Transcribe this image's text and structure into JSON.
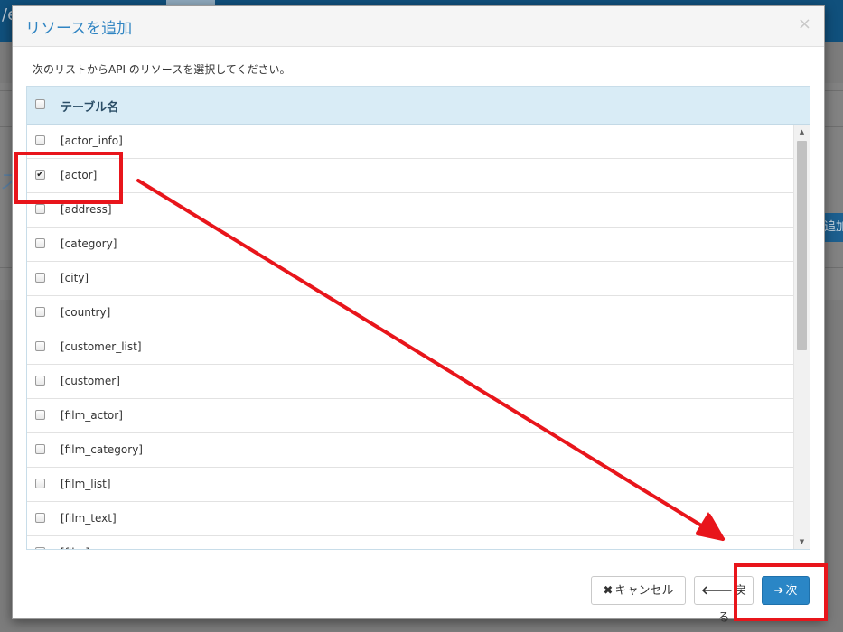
{
  "background": {
    "topbar_letter": "/e",
    "side_char": "ス",
    "add_button_label": "追加"
  },
  "modal": {
    "title": "リソースを追加",
    "close_label": "×",
    "instruction": "次のリストからAPI のリソースを選択してください。"
  },
  "table": {
    "header_label": "テーブル名",
    "rows": [
      {
        "label": "[actor_info]",
        "checked": false
      },
      {
        "label": "[actor]",
        "checked": true
      },
      {
        "label": "[address]",
        "checked": false
      },
      {
        "label": "[category]",
        "checked": false
      },
      {
        "label": "[city]",
        "checked": false
      },
      {
        "label": "[country]",
        "checked": false
      },
      {
        "label": "[customer_list]",
        "checked": false
      },
      {
        "label": "[customer]",
        "checked": false
      },
      {
        "label": "[film_actor]",
        "checked": false
      },
      {
        "label": "[film_category]",
        "checked": false
      },
      {
        "label": "[film_list]",
        "checked": false
      },
      {
        "label": "[film_text]",
        "checked": false
      },
      {
        "label": "[film]",
        "checked": false
      }
    ]
  },
  "footer": {
    "cancel_label": "キャンセル",
    "back_label": "戻る",
    "next_label": "次"
  },
  "colors": {
    "accent": "#2a86c6",
    "title": "#2f84c2",
    "header_bg": "#d9ecf6",
    "annotation": "#e8151b"
  }
}
